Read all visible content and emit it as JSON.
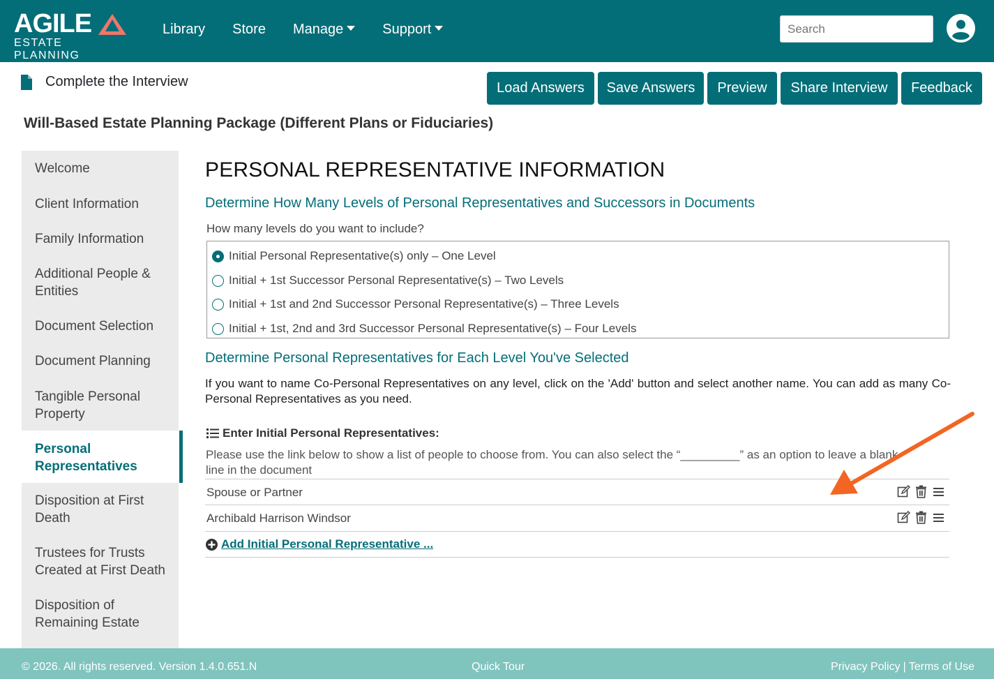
{
  "brand": {
    "name": "AGILE",
    "tagline": "ESTATE PLANNING",
    "accent": "#f0766a",
    "primary": "#046e78"
  },
  "nav": {
    "items": [
      {
        "label": "Library",
        "dropdown": false
      },
      {
        "label": "Store",
        "dropdown": false
      },
      {
        "label": "Manage",
        "dropdown": true
      },
      {
        "label": "Support",
        "dropdown": true
      }
    ]
  },
  "search": {
    "placeholder": "Search",
    "value": ""
  },
  "header": {
    "title": "Complete the Interview"
  },
  "toolbar": {
    "load": "Load Answers",
    "save": "Save Answers",
    "preview": "Preview",
    "share": "Share Interview",
    "feedback": "Feedback"
  },
  "package_title": "Will-Based Estate Planning Package (Different Plans or Fiduciaries)",
  "sidebar": {
    "items": [
      {
        "label": "Welcome"
      },
      {
        "label": "Client Information"
      },
      {
        "label": "Family Information"
      },
      {
        "label": "Additional People & Entities"
      },
      {
        "label": "Document Selection"
      },
      {
        "label": "Document Planning"
      },
      {
        "label": "Tangible Personal Property"
      },
      {
        "label": "Personal Representatives",
        "active": true
      },
      {
        "label": "Disposition at First Death"
      },
      {
        "label": "Trustees for Trusts Created at First Death"
      },
      {
        "label": "Disposition of Remaining Estate"
      }
    ]
  },
  "main": {
    "heading": "PERSONAL REPRESENTATIVE INFORMATION",
    "section1": "Determine How Many Levels of Personal Representatives and Successors in Documents",
    "question": "How many levels do you want to include?",
    "options": [
      {
        "label": "Initial Personal Representative(s) only – One Level",
        "checked": true
      },
      {
        "label": "Initial + 1st Successor Personal Representative(s) – Two Levels",
        "checked": false
      },
      {
        "label": "Initial + 1st and 2nd Successor Personal Representative(s) – Three Levels",
        "checked": false
      },
      {
        "label": "Initial + 1st, 2nd and 3rd Successor Personal Representative(s) – Four Levels",
        "checked": false
      }
    ],
    "section2": "Determine Personal Representatives for Each Level You've Selected",
    "paragraph": "If you want to name Co-Personal Representatives on any level, click on the 'Add' button and select another name. You can add as many Co-Personal Representatives as you need.",
    "list_heading": "Enter Initial Personal Representatives:",
    "hint": "Please use the link below to show a list of people to choose from. You can also select the “_________” as an option to leave a blank line in the document",
    "representatives": [
      {
        "name": "Spouse or Partner"
      },
      {
        "name": "Archibald Harrison Windsor"
      }
    ],
    "add_link": "Add Initial Personal Representative ..."
  },
  "footer": {
    "copyright": "© 2026. All rights reserved. Version 1.4.0.651.N",
    "tour": "Quick Tour",
    "privacy": "Privacy Policy",
    "separator": "|",
    "terms": "Terms of Use"
  },
  "annotation_color": "#f26522"
}
